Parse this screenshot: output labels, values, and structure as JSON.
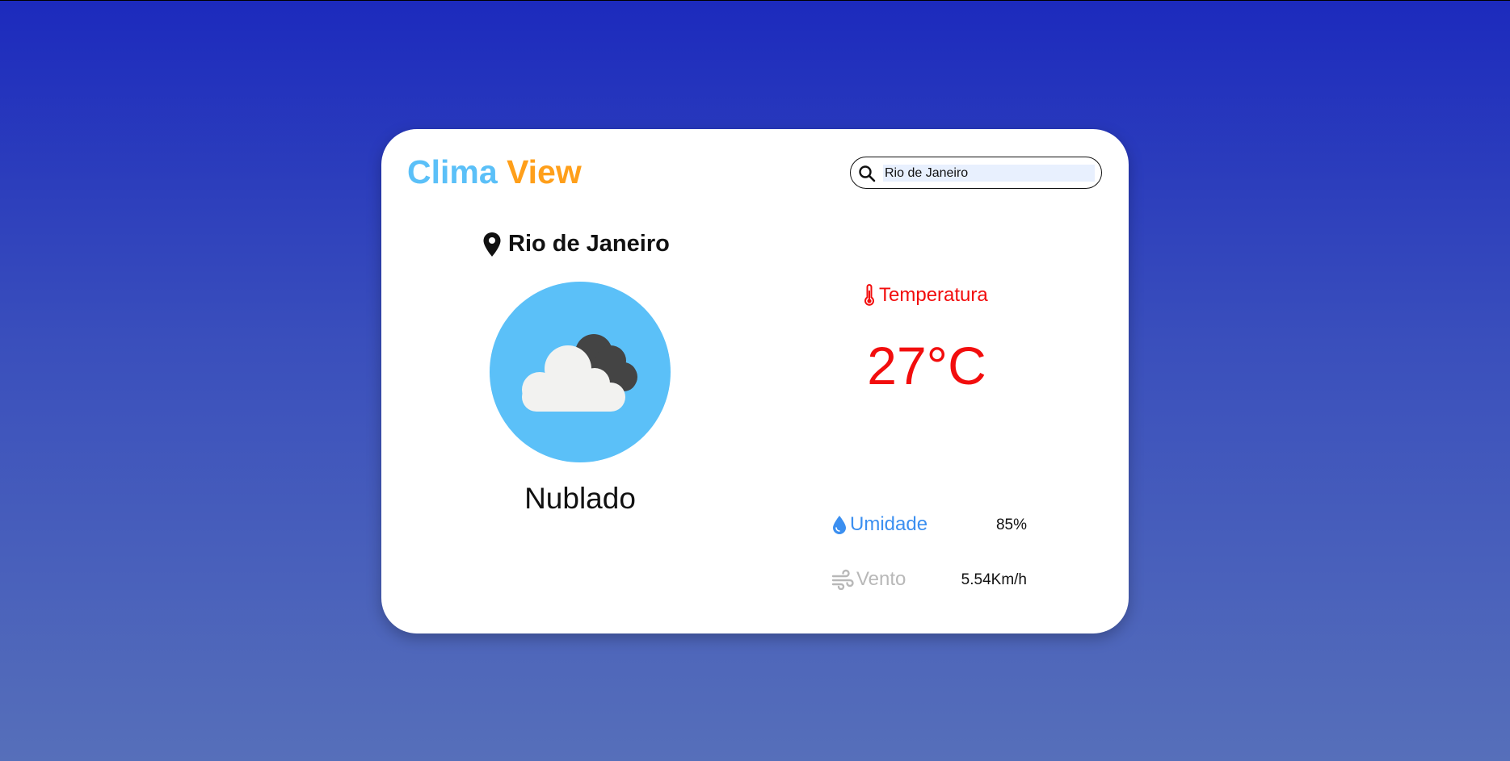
{
  "logo": {
    "part1": "Clima",
    "part2": "View"
  },
  "search": {
    "value": "Rio de Janeiro",
    "icon": "search-icon"
  },
  "location": {
    "city": "Rio de Janeiro",
    "icon": "map-pin-icon"
  },
  "weather": {
    "icon": "cloudy-icon",
    "condition": "Nublado"
  },
  "temperature": {
    "label": "Temperatura",
    "icon": "thermometer-icon",
    "value": "27°C"
  },
  "stats": {
    "humidity": {
      "label": "Umidade",
      "value": "85%",
      "icon": "water-drop-icon"
    },
    "wind": {
      "label": "Vento",
      "value": "5.54Km/h",
      "icon": "wind-icon"
    }
  },
  "colors": {
    "logo_part1": "#5bc0f8",
    "logo_part2": "#ff9f1a",
    "temperature": "#f20d0d",
    "humidity": "#3b8ff0",
    "wind": "#b8b8b8",
    "weather_circle": "#5bc0f8"
  }
}
